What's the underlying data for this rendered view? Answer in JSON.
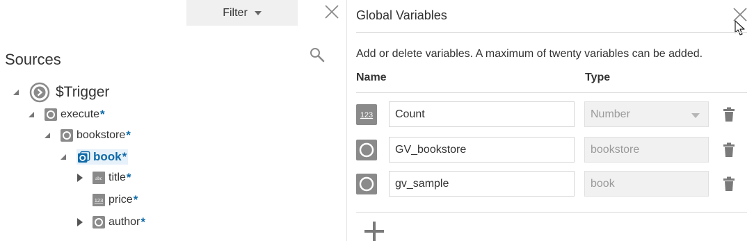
{
  "filter": {
    "label": "Filter"
  },
  "sources": {
    "title": "Sources",
    "tree": {
      "trigger": "$Trigger",
      "execute": "execute",
      "bookstore": "bookstore",
      "book": "book",
      "title": "title",
      "price": "price",
      "author": "author",
      "required_mark": "*",
      "abc_badge": "abc",
      "num_badge": "123"
    }
  },
  "global_variables": {
    "title": "Global Variables",
    "description": "Add or delete variables. A maximum of twenty variables can be added.",
    "col_name": "Name",
    "col_type": "Type",
    "rows": [
      {
        "icon": "number-type-icon",
        "icon_text": "123",
        "name": "Count",
        "type": "Number",
        "type_has_dropdown": true
      },
      {
        "icon": "object-type-icon",
        "name": "GV_bookstore",
        "type": "bookstore",
        "type_has_dropdown": false
      },
      {
        "icon": "object-type-icon",
        "name": "gv_sample",
        "type": "book",
        "type_has_dropdown": false
      }
    ]
  },
  "colors": {
    "accent": "#0f6aa8",
    "selected_bg": "#e7f1fa",
    "icon_gray": "#8a8a8a",
    "field_disabled_bg": "#f1f1f1"
  }
}
